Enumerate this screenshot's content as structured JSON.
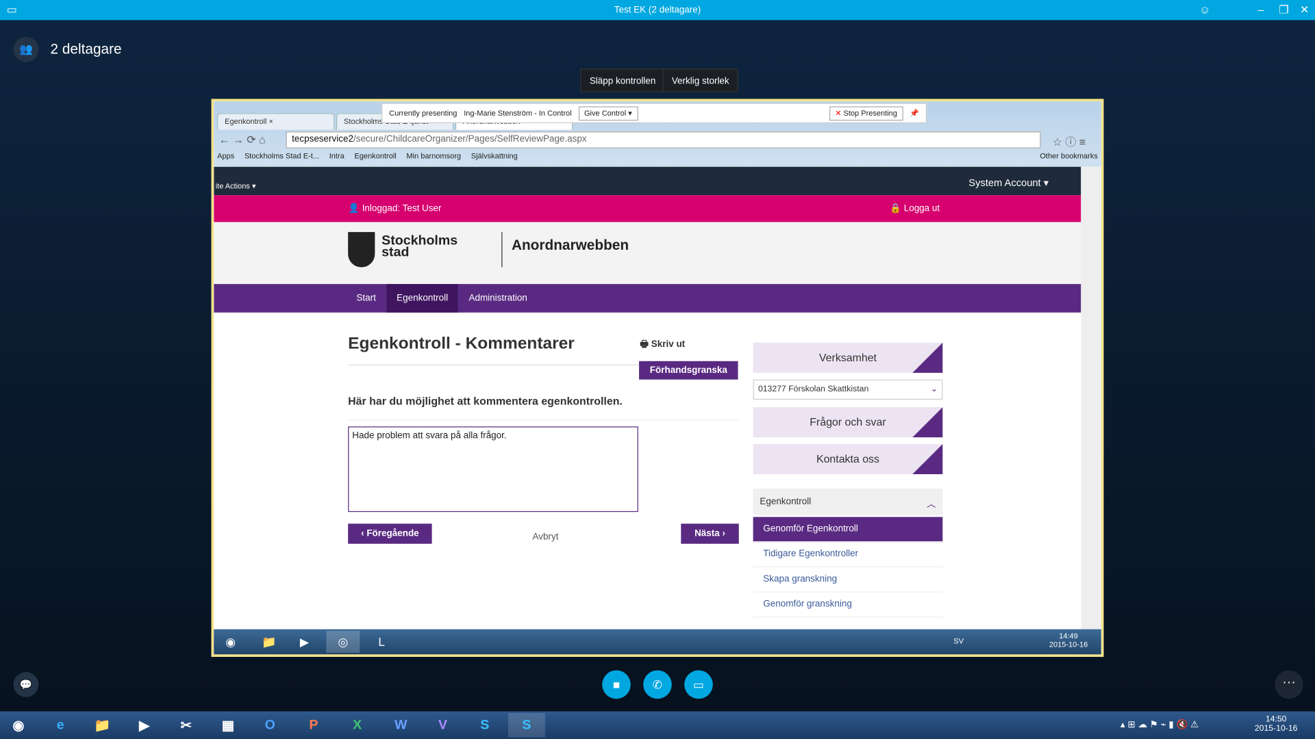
{
  "window": {
    "title": "Test EK (2 deltagare)"
  },
  "participants": {
    "label": "2 deltagare"
  },
  "controls": {
    "release": "Släpp kontrollen",
    "actual_size": "Verklig storlek"
  },
  "presenting": {
    "label": "Currently presenting",
    "user": "Ing-Marie Stenström - In Control",
    "give_control": "Give Control",
    "stop": "Stop Presenting"
  },
  "browser": {
    "tabs": [
      "Egenkontroll",
      "Stockholms Stad E-tjänst",
      "Anordnarwebben"
    ],
    "url_host": "tecpseservice2",
    "url_path": "/secure/ChildcareOrganizer/Pages/SelfReviewPage.aspx",
    "bookmarks": [
      "Apps",
      "Stockholms Stad E-t...",
      "Intra",
      "Egenkontroll",
      "Min barnomsorg",
      "Självskattning"
    ],
    "other_bookmarks": "Other bookmarks"
  },
  "site": {
    "site_actions": "ite Actions",
    "system_account": "System Account",
    "logged_in": "Inloggad: Test User",
    "logout": "Logga ut",
    "logo_line1": "Stockholms",
    "logo_line2": "stad",
    "app_name": "Anordnarwebben",
    "nav": [
      "Start",
      "Egenkontroll",
      "Administration"
    ],
    "title": "Egenkontroll - Kommentarer",
    "print": "Skriv ut",
    "preview": "Förhandsgranska",
    "intro": "Här har du möjlighet att kommentera egenkontrollen.",
    "comment": "Hade problem att svara på alla frågor.",
    "prev": "‹ Föregående",
    "cancel": "Avbryt",
    "next": "Nästa ›",
    "side": {
      "verksamhet": "Verksamhet",
      "selected": "013277 Förskolan Skattkistan",
      "faq": "Frågor och svar",
      "contact": "Kontakta oss",
      "section": "Egenkontroll",
      "links": [
        "Genomför Egenkontroll",
        "Tidigare Egenkontroller",
        "Skapa granskning",
        "Genomför granskning"
      ]
    }
  },
  "remote_taskbar": {
    "lang": "SV",
    "time": "14:49",
    "date": "2015-10-16"
  },
  "taskbar": {
    "time": "14:50",
    "date": "2015-10-16"
  },
  "colors": {
    "accent": "#00a7e0",
    "pink": "#d6006e",
    "purple": "#5a2a82"
  }
}
